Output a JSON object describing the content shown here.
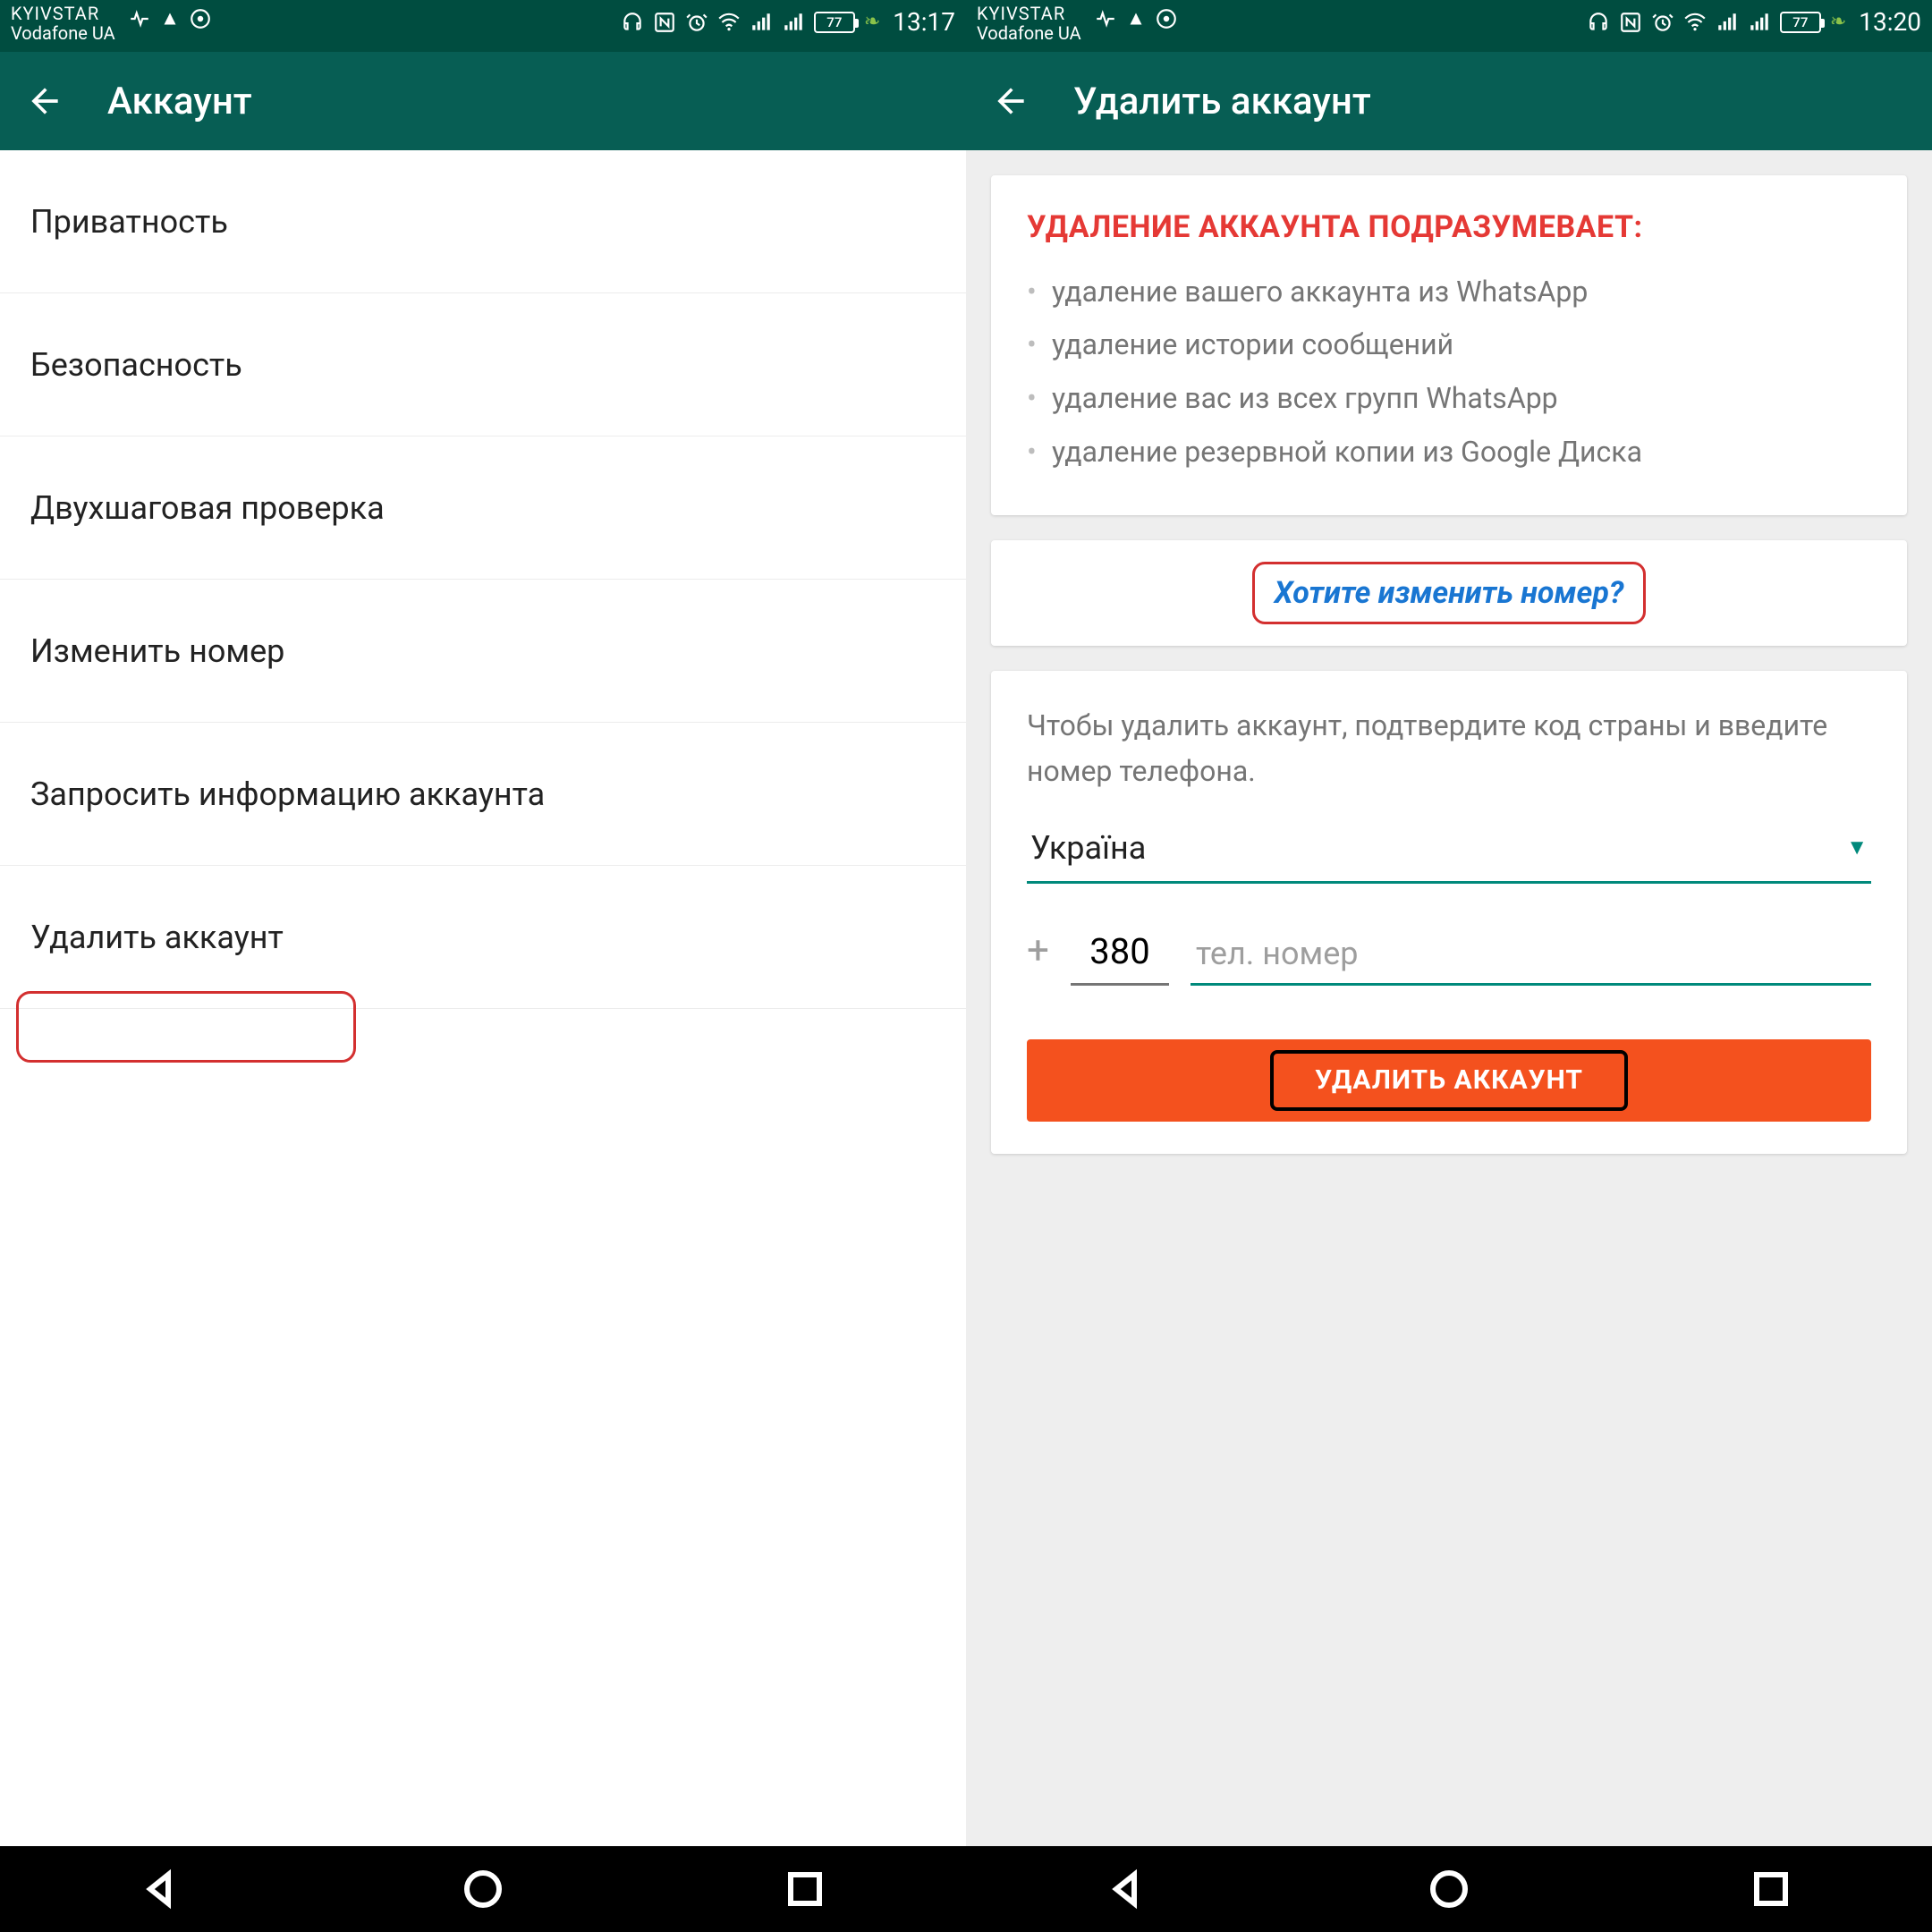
{
  "left": {
    "statusbar": {
      "carrier1": "KYIVSTAR",
      "carrier2": "Vodafone UA",
      "battery": "77",
      "time": "13:17"
    },
    "appbar": {
      "title": "Аккаунт"
    },
    "menu": {
      "items": [
        "Приватность",
        "Безопасность",
        "Двухшаговая проверка",
        "Изменить номер",
        "Запросить информацию аккаунта",
        "Удалить аккаунт"
      ]
    }
  },
  "right": {
    "statusbar": {
      "carrier1": "KYIVSTAR",
      "carrier2": "Vodafone UA",
      "battery": "77",
      "time": "13:20"
    },
    "appbar": {
      "title": "Удалить аккаунт"
    },
    "warning": {
      "title": "УДАЛЕНИЕ АККАУНТА ПОДРАЗУМЕВАЕТ:",
      "bullets": [
        "удаление вашего аккаунта из WhatsApp",
        "удаление истории сообщений",
        "удаление вас из всех групп WhatsApp",
        "удаление резервной копии из Google Диска"
      ]
    },
    "change_link": "Хотите изменить номер?",
    "form": {
      "instruction": "Чтобы удалить аккаунт, подтвердите код страны и введите номер телефона.",
      "country": "Україна",
      "plus": "+",
      "country_code": "380",
      "phone_placeholder": "тел. номер",
      "delete_button": "УДАЛИТЬ АККАУНТ"
    }
  }
}
